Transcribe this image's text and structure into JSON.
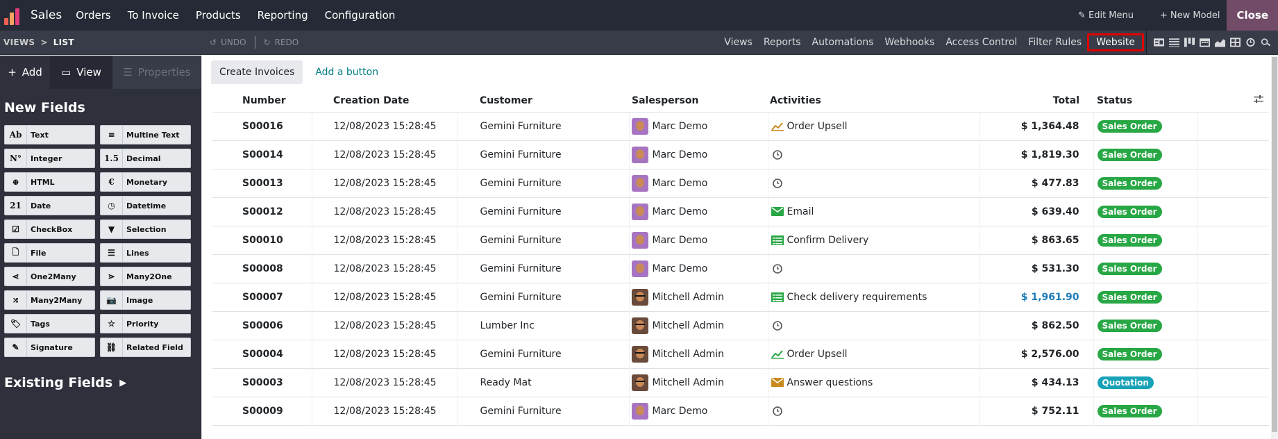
{
  "topbar": {
    "app_name": "Sales",
    "menu": [
      "Orders",
      "To Invoice",
      "Products",
      "Reporting",
      "Configuration"
    ],
    "edit_menu": "Edit Menu",
    "new_model": "New Model",
    "close": "Close"
  },
  "subbar": {
    "crumb_root": "VIEWS",
    "crumb_sep": ">",
    "crumb_current": "LIST",
    "undo": "UNDO",
    "redo": "REDO",
    "nav": [
      "Views",
      "Reports",
      "Automations",
      "Webhooks",
      "Access Control",
      "Filter Rules",
      "Website"
    ],
    "highlighted": "Website",
    "view_icons": [
      "form-view-icon",
      "list-view-icon",
      "kanban-view-icon",
      "calendar-view-icon",
      "graph-view-icon",
      "pivot-view-icon",
      "activity-view-icon",
      "search-view-icon"
    ]
  },
  "sidebar": {
    "tabs": [
      "Add",
      "View",
      "Properties"
    ],
    "new_fields_title": "New Fields",
    "fields": [
      {
        "icon": "Ab",
        "label": "Text"
      },
      {
        "icon": "≡",
        "label": "Multine Text"
      },
      {
        "icon": "N°",
        "label": "Integer"
      },
      {
        "icon": "1.5",
        "label": "Decimal"
      },
      {
        "icon": "⊕",
        "label": "HTML"
      },
      {
        "icon": "€",
        "label": "Monetary"
      },
      {
        "icon": "21",
        "label": "Date"
      },
      {
        "icon": "◷",
        "label": "Datetime"
      },
      {
        "icon": "☑",
        "label": "CheckBox"
      },
      {
        "icon": "▼",
        "label": "Selection"
      },
      {
        "icon": "🗋",
        "label": "File"
      },
      {
        "icon": "☰",
        "label": "Lines"
      },
      {
        "icon": "⋖",
        "label": "One2Many"
      },
      {
        "icon": "⋗",
        "label": "Many2One"
      },
      {
        "icon": "⤨",
        "label": "Many2Many"
      },
      {
        "icon": "📷",
        "label": "Image"
      },
      {
        "icon": "🏷",
        "label": "Tags"
      },
      {
        "icon": "☆",
        "label": "Priority"
      },
      {
        "icon": "✎",
        "label": "Signature"
      },
      {
        "icon": "⛓",
        "label": "Related Field"
      }
    ],
    "existing_fields_title": "Existing Fields"
  },
  "main": {
    "create_invoices": "Create Invoices",
    "add_button": "Add a button",
    "columns": [
      "Number",
      "Creation Date",
      "Customer",
      "Salesperson",
      "Activities",
      "Total",
      "Status"
    ],
    "rows": [
      {
        "number": "S00016",
        "date": "12/08/2023 15:28:45",
        "customer": "Gemini Furniture",
        "salesperson": "Marc Demo",
        "avatar": "marc",
        "activity": "Order Upsell",
        "activity_icon": "upsell",
        "total": "$ 1,364.48",
        "status": "Sales Order",
        "status_kind": "so"
      },
      {
        "number": "S00014",
        "date": "12/08/2023 15:28:45",
        "customer": "Gemini Furniture",
        "salesperson": "Marc Demo",
        "avatar": "marc",
        "activity": "",
        "activity_icon": "clock",
        "total": "$ 1,819.30",
        "status": "Sales Order",
        "status_kind": "so"
      },
      {
        "number": "S00013",
        "date": "12/08/2023 15:28:45",
        "customer": "Gemini Furniture",
        "salesperson": "Marc Demo",
        "avatar": "marc",
        "activity": "",
        "activity_icon": "clock",
        "total": "$ 477.83",
        "status": "Sales Order",
        "status_kind": "so"
      },
      {
        "number": "S00012",
        "date": "12/08/2023 15:28:45",
        "customer": "Gemini Furniture",
        "salesperson": "Marc Demo",
        "avatar": "marc",
        "activity": "Email",
        "activity_icon": "email-green",
        "total": "$ 639.40",
        "status": "Sales Order",
        "status_kind": "so"
      },
      {
        "number": "S00010",
        "date": "12/08/2023 15:28:45",
        "customer": "Gemini Furniture",
        "salesperson": "Marc Demo",
        "avatar": "marc",
        "activity": "Confirm Delivery",
        "activity_icon": "todo",
        "total": "$ 863.65",
        "status": "Sales Order",
        "status_kind": "so"
      },
      {
        "number": "S00008",
        "date": "12/08/2023 15:28:45",
        "customer": "Gemini Furniture",
        "salesperson": "Marc Demo",
        "avatar": "marc",
        "activity": "",
        "activity_icon": "clock",
        "total": "$ 531.30",
        "status": "Sales Order",
        "status_kind": "so"
      },
      {
        "number": "S00007",
        "date": "12/08/2023 15:28:45",
        "customer": "Gemini Furniture",
        "salesperson": "Mitchell Admin",
        "avatar": "mitch",
        "activity": "Check delivery requirements",
        "activity_icon": "todo",
        "total": "$ 1,961.90",
        "total_blue": true,
        "status": "Sales Order",
        "status_kind": "so"
      },
      {
        "number": "S00006",
        "date": "12/08/2023 15:28:45",
        "customer": "Lumber Inc",
        "salesperson": "Mitchell Admin",
        "avatar": "mitch",
        "activity": "",
        "activity_icon": "clock",
        "total": "$ 862.50",
        "status": "Sales Order",
        "status_kind": "so"
      },
      {
        "number": "S00004",
        "date": "12/08/2023 15:28:45",
        "customer": "Gemini Furniture",
        "salesperson": "Mitchell Admin",
        "avatar": "mitch",
        "activity": "Order Upsell",
        "activity_icon": "upsell-green",
        "total": "$ 2,576.00",
        "status": "Sales Order",
        "status_kind": "so"
      },
      {
        "number": "S00003",
        "date": "12/08/2023 15:28:45",
        "customer": "Ready Mat",
        "salesperson": "Mitchell Admin",
        "avatar": "mitch",
        "activity": "Answer questions",
        "activity_icon": "email-orange",
        "total": "$ 434.13",
        "status": "Quotation",
        "status_kind": "qt"
      },
      {
        "number": "S00009",
        "date": "12/08/2023 15:28:45",
        "customer": "Gemini Furniture",
        "salesperson": "Marc Demo",
        "avatar": "marc",
        "activity": "",
        "activity_icon": "clock",
        "total": "$ 752.11",
        "status": "Sales Order",
        "status_kind": "so"
      }
    ]
  },
  "colors": {
    "topbar": "#262a36",
    "close": "#714b67",
    "highlight": "#e00000",
    "sales_order": "#28a745",
    "quotation": "#17a2b8"
  }
}
